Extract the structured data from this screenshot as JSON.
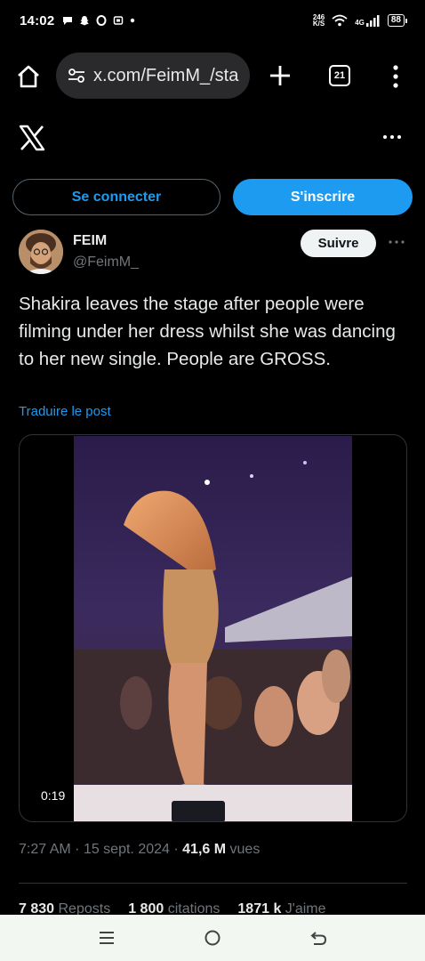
{
  "status_bar": {
    "time": "14:02",
    "net_speed_value": "246",
    "net_speed_unit": "K/S",
    "network": "4G",
    "battery": "88"
  },
  "browser": {
    "url": "x.com/FeimM_/sta",
    "tab_count": "21"
  },
  "auth": {
    "login_label": "Se connecter",
    "signup_label": "S'inscrire"
  },
  "post": {
    "author_name": "FEIM",
    "author_handle": "@FeimM_",
    "follow_label": "Suivre",
    "text": "Shakira leaves the stage after people were filming under her dress whilst she was dancing to her new single. People are GROSS.",
    "translate_label": "Traduire le post",
    "video_duration": "0:19",
    "time": "7:27 AM",
    "date": "15 sept. 2024",
    "views_count": "41,6 M",
    "views_label": "vues",
    "reposts_count": "7 830",
    "reposts_label": "Reposts",
    "quotes_count": "1 800",
    "quotes_label": "citations",
    "likes_count": "1871 k",
    "likes_label": "J'aime"
  },
  "icons": {
    "home": "home-icon",
    "tune": "site-settings-icon",
    "plus": "plus-icon",
    "menu": "kebab-menu-icon",
    "x_logo": "x-logo-icon",
    "more": "more-horizontal-icon",
    "nav_menu": "hamburger-icon",
    "nav_home": "circle-home-icon",
    "nav_back": "back-icon"
  },
  "colors": {
    "accent": "#1d9bf0",
    "background": "#000000",
    "secondary_text": "#71767b"
  }
}
